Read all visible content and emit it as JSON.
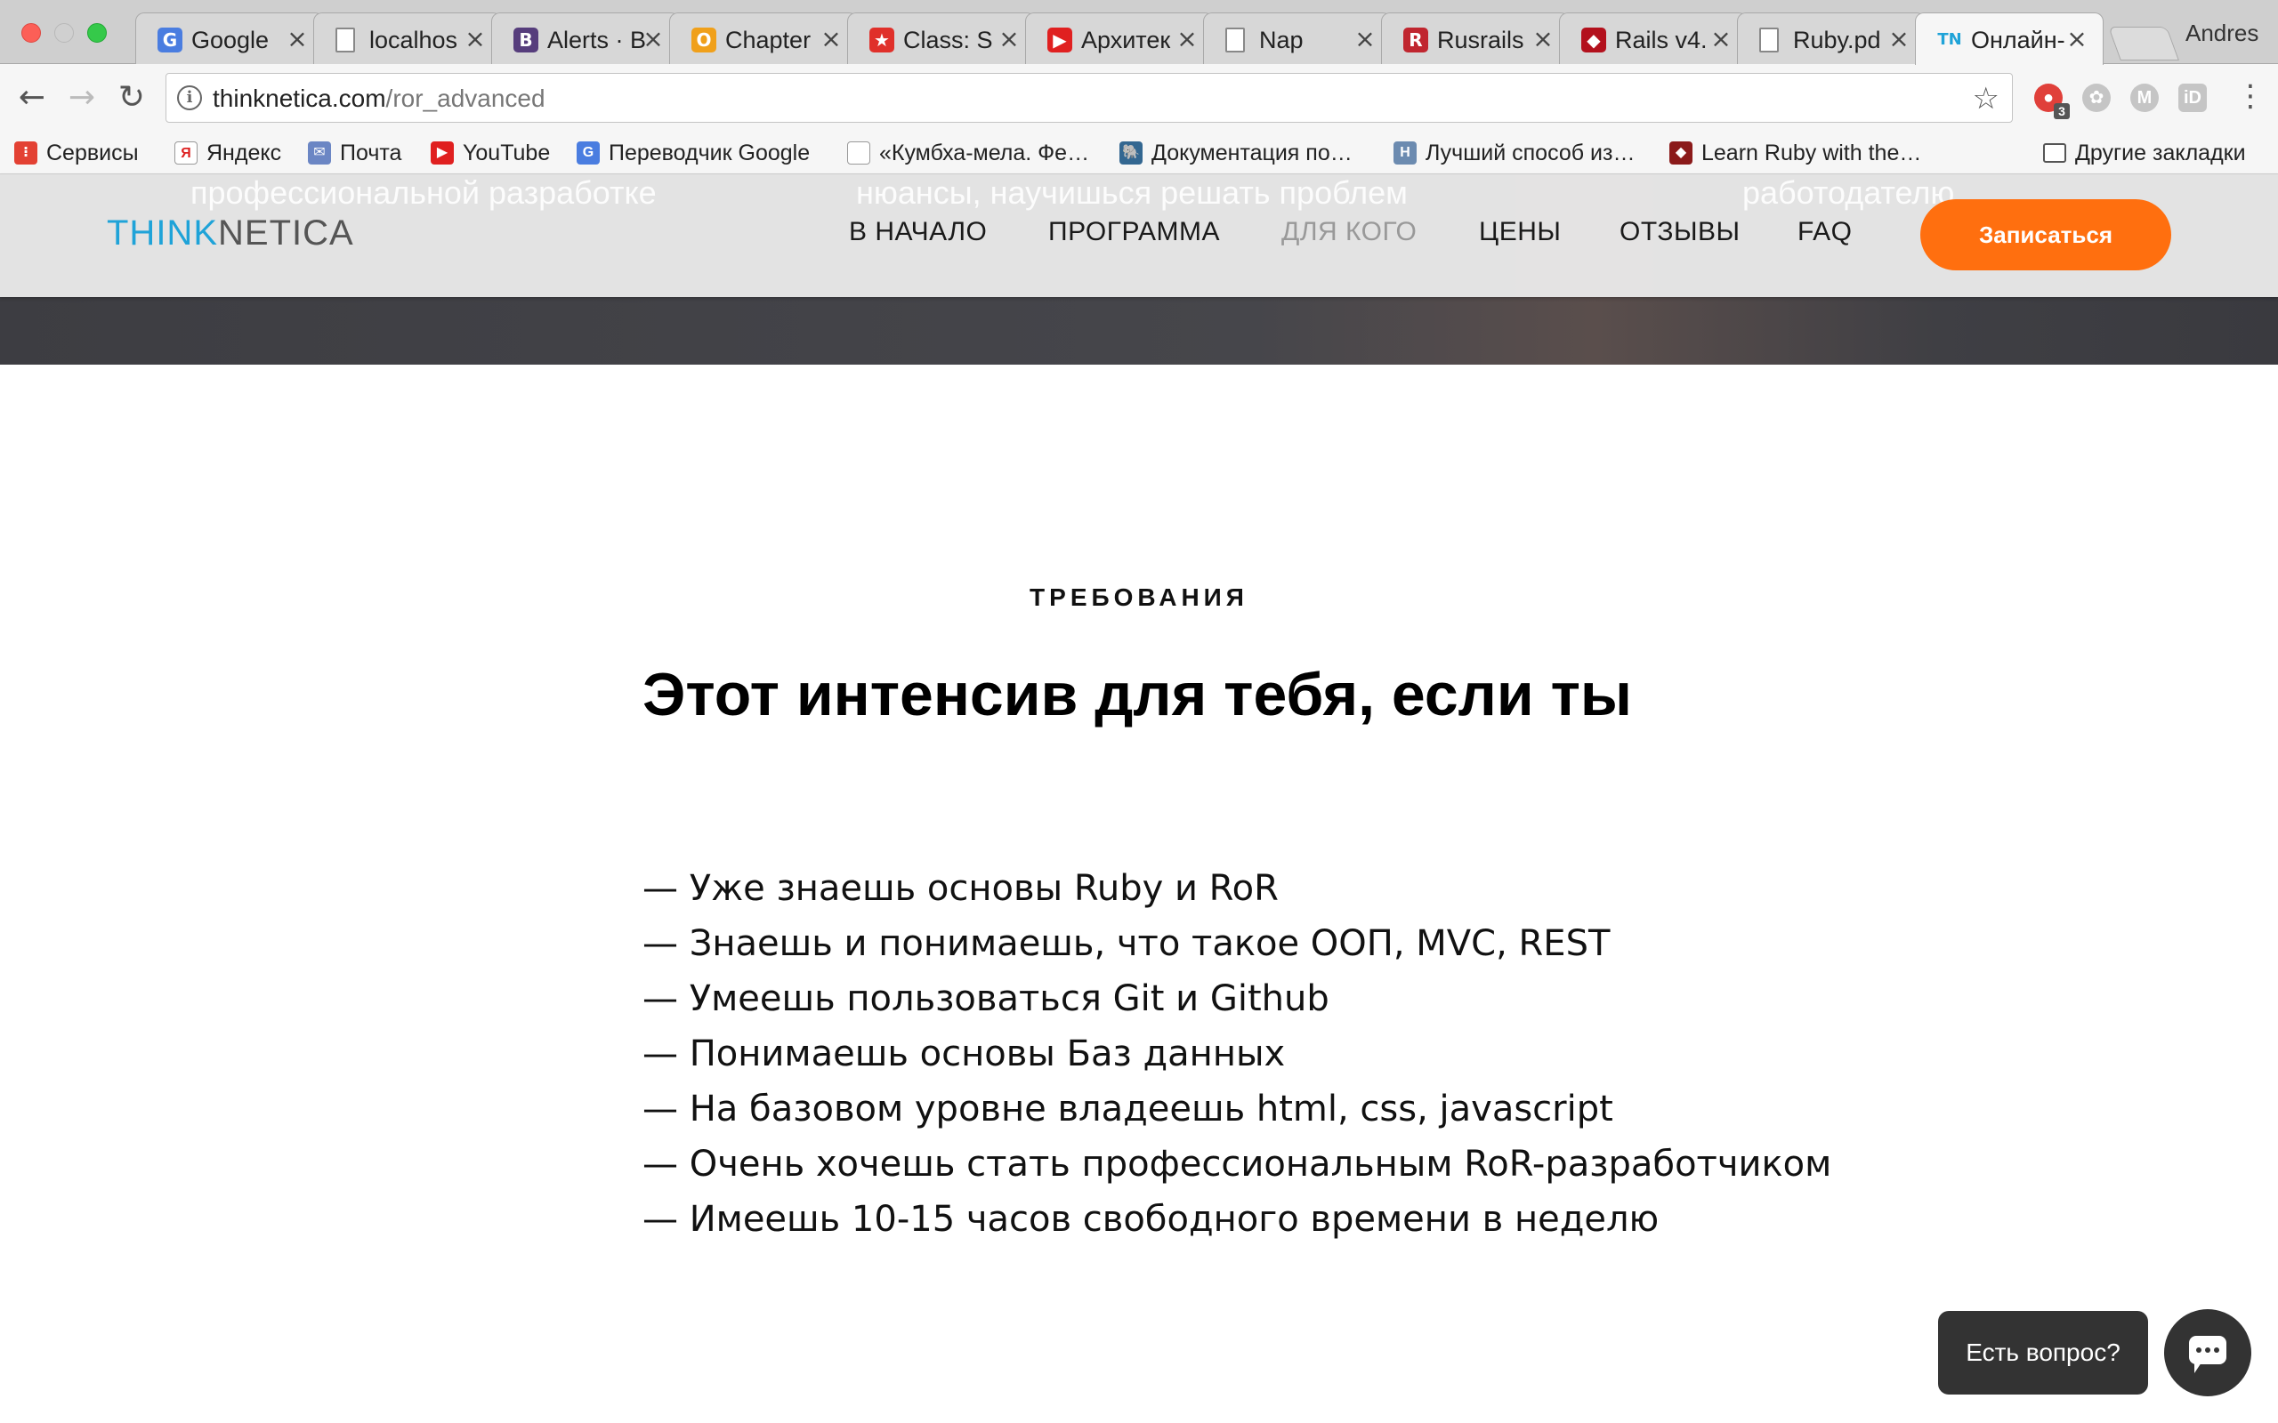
{
  "browser": {
    "profile_name": "Andres",
    "tabs": [
      {
        "title": "Google",
        "favicon": "google-translate-icon",
        "color": "#4a7de0",
        "glyph": "G"
      },
      {
        "title": "localhos",
        "favicon": "page-icon",
        "color": "#999999",
        "glyph": ""
      },
      {
        "title": "Alerts · B",
        "favicon": "bootstrap-icon",
        "color": "#563d7c",
        "glyph": "B"
      },
      {
        "title": "Chapter",
        "favicon": "opera-icon",
        "color": "#f0a01a",
        "glyph": "O"
      },
      {
        "title": "Class: S",
        "favicon": "thumbs-up-icon",
        "color": "#e0302a",
        "glyph": "★"
      },
      {
        "title": "Архитек",
        "favicon": "youtube-icon",
        "color": "#e02020",
        "glyph": "▶"
      },
      {
        "title": "Nap",
        "favicon": "page-icon",
        "color": "#999999",
        "glyph": ""
      },
      {
        "title": "Rusrails",
        "favicon": "rusrails-icon",
        "color": "#c0262f",
        "glyph": "R"
      },
      {
        "title": "Rails v4.",
        "favicon": "ruby-icon",
        "color": "#b3111d",
        "glyph": "◆"
      },
      {
        "title": "Ruby.pd",
        "favicon": "page-icon",
        "color": "#999999",
        "glyph": ""
      },
      {
        "title": "Онлайн-",
        "favicon": "thinknetica-icon",
        "color": "#1fa3d8",
        "glyph": "TN",
        "active": true
      }
    ],
    "address": {
      "host": "thinknetica.com",
      "path": "/ror_advanced"
    },
    "extensions": [
      {
        "name": "adblock-extension-icon",
        "glyph": "●",
        "badge": "3"
      },
      {
        "name": "paw-extension-icon",
        "glyph": "✿",
        "badge": ""
      },
      {
        "name": "m-extension-icon",
        "glyph": "M",
        "badge": ""
      },
      {
        "name": "id-extension-icon",
        "glyph": "iD",
        "badge": ""
      }
    ],
    "bookmarks": [
      {
        "label": "Сервисы",
        "icon": "apps-grid-icon",
        "color": "#e34133",
        "glyph": "⁝"
      },
      {
        "label": "Яндекс",
        "icon": "yandex-icon",
        "color": "#ffffff",
        "glyph": "Я"
      },
      {
        "label": "Почта",
        "icon": "mail-icon",
        "color": "#6b86c4",
        "glyph": "✉"
      },
      {
        "label": "YouTube",
        "icon": "youtube-icon",
        "color": "#e02020",
        "glyph": "▶"
      },
      {
        "label": "Переводчик Google",
        "icon": "google-translate-icon",
        "color": "#4a7de0",
        "glyph": "G"
      },
      {
        "label": "«Кумбха-мела. Фе…",
        "icon": "page-icon",
        "color": "#ffffff",
        "glyph": ""
      },
      {
        "label": "Документация по…",
        "icon": "postgres-icon",
        "color": "#336791",
        "glyph": "🐘"
      },
      {
        "label": "Лучший способ из…",
        "icon": "h-icon",
        "color": "#6c8bb0",
        "glyph": "H"
      },
      {
        "label": "Learn Ruby with the…",
        "icon": "ruby-icon",
        "color": "#8b1a1a",
        "glyph": "◆"
      }
    ],
    "bookmarks_overflow": "»",
    "other_bookmarks": "Другие закладки"
  },
  "site": {
    "logo_part1": "THINK",
    "logo_part2": "NETICA",
    "ghost_texts": [
      "профессиональной разработке",
      "нюансы, научишься решать проблем",
      "работодателю"
    ],
    "nav": [
      {
        "label": "В НАЧАЛО",
        "muted": false
      },
      {
        "label": "ПРОГРАММА",
        "muted": false
      },
      {
        "label": "ДЛЯ КОГО",
        "muted": true
      },
      {
        "label": "ЦЕНЫ",
        "muted": false
      },
      {
        "label": "ОТЗЫВЫ",
        "muted": false
      },
      {
        "label": "FAQ",
        "muted": false
      }
    ],
    "cta_label": "Записаться",
    "accent_color": "#ff6f0f"
  },
  "section": {
    "label": "ТРЕБОВАНИЯ",
    "title": "Этот интенсив для тебя, если ты",
    "items": [
      "— Уже знаешь основы Ruby и RoR",
      "— Знаешь и понимаешь, что такое ООП, MVC, REST",
      "— Умеешь пользоваться Git и Github",
      "— Понимаешь основы Баз данных",
      "— На базовом уровне владеешь html, css, javascript",
      "— Очень хочешь стать профессиональным RoR-разработчиком",
      "— Имеешь 10-15 часов свободного времени в неделю"
    ]
  },
  "chat": {
    "prompt": "Есть вопрос?"
  }
}
